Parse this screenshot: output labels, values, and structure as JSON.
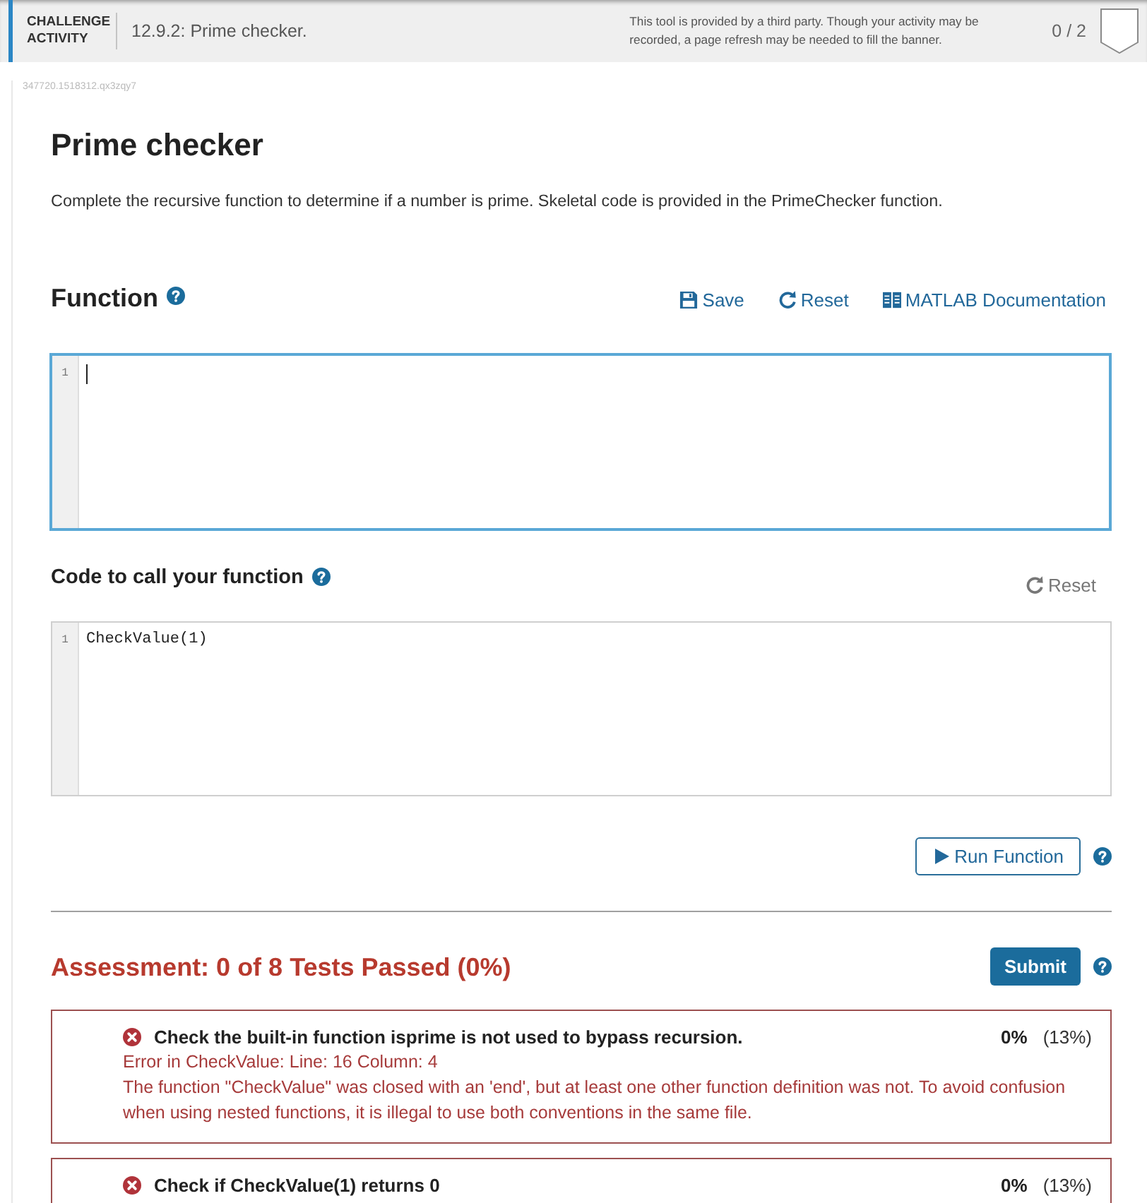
{
  "header": {
    "label": "CHALLENGE ACTIVITY",
    "title": "12.9.2: Prime checker.",
    "notice": "This tool is provided by a third party. Though your activity may be recorded, a page refresh may be needed to fill the banner.",
    "score": "0 / 2"
  },
  "activity_id": "347720.1518312.qx3zqy7",
  "title": "Prime checker",
  "description": "Complete the recursive function to determine if a number is prime. Skeletal code is provided in the PrimeChecker function.",
  "function_section": {
    "heading": "Function",
    "actions": [
      {
        "kind": "save",
        "label": "Save",
        "disabled": false
      },
      {
        "kind": "reset",
        "label": "Reset",
        "disabled": false
      },
      {
        "kind": "docs",
        "label": "MATLAB Documentation",
        "disabled": false
      }
    ],
    "editor": {
      "focused": true,
      "lines": [
        {
          "number": "1"
        }
      ]
    }
  },
  "call_section": {
    "heading": "Code to call your function",
    "actions": [
      {
        "kind": "reset",
        "label": "Reset",
        "disabled": true
      }
    ],
    "editor": {
      "focused": false,
      "lines": [
        {
          "number": "1",
          "code": "CheckValue(1)"
        }
      ]
    }
  },
  "run_button": "Run Function",
  "assessment": {
    "heading": "Assessment: 0 of 8 Tests Passed (0%)",
    "submit": "Submit",
    "tests": [
      {
        "passed": false,
        "title": "Check the built-in function isprime is not used to bypass recursion.",
        "score": "0%",
        "weight": "(13%)",
        "details": [
          "Error in CheckValue: Line: 16 Column: 4",
          "The function \"CheckValue\" was closed with an 'end', but at least one other function definition was not. To avoid confusion when using nested functions, it is illegal to use both conventions in the same file."
        ]
      },
      {
        "passed": false,
        "title": "Check if CheckValue(1) returns 0",
        "score": "0%",
        "weight": "(13%)"
      }
    ]
  }
}
